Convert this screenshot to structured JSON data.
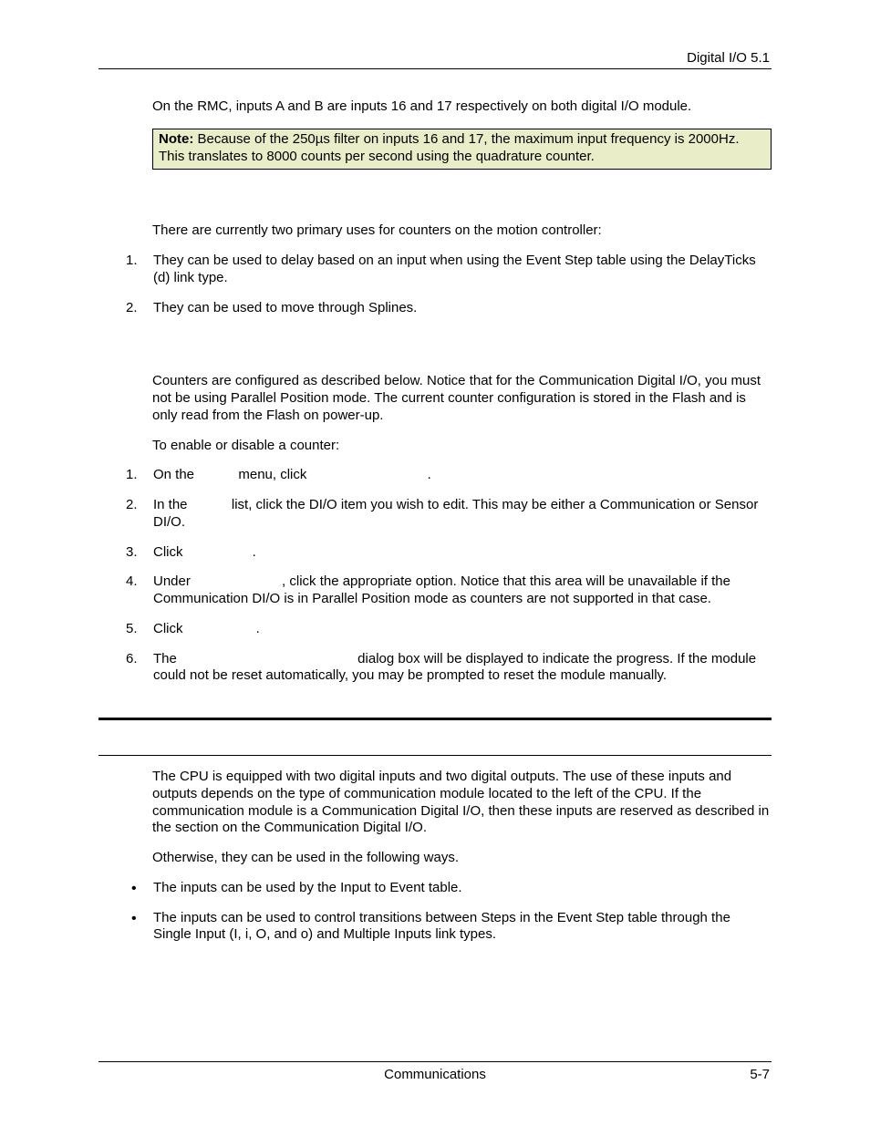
{
  "header": {
    "right": "Digital I/O  5.1"
  },
  "body": {
    "p1": "On the RMC, inputs A and B are inputs 16 and 17 respectively on both digital I/O module.",
    "note_label": "Note:",
    "note_text": " Because of the 250µs filter on inputs 16 and 17, the maximum input frequency is 2000Hz. This translates to 8000 counts per second using the quadrature counter.",
    "p2": "There are currently two primary uses for counters on the motion controller:",
    "list1": {
      "i1": "They can be used to delay based on an input when using the Event Step table using the DelayTicks (d) link type.",
      "i2": "They can be used to move through Splines."
    },
    "p3": "Counters are configured as described below. Notice that for the Communication Digital I/O, you must not be using Parallel Position mode. The current counter configuration is stored in the Flash and is only read from the Flash on power-up.",
    "p4": "To enable or disable a counter:",
    "list2": {
      "i1a": "On the ",
      "i1b": " menu, click ",
      "i1c": ".",
      "i2a": "In the ",
      "i2b": " list, click the DI/O item you wish to edit. This may be either a Communication or Sensor DI/O.",
      "i3a": "Click ",
      "i3b": ".",
      "i4a": "Under ",
      "i4b": ", click the appropriate option. Notice that this area will be unavailable if the Communication DI/O is in Parallel Position mode as counters are not supported in that case.",
      "i5a": "Click ",
      "i5b": ".",
      "i6a": "The ",
      "i6b": " dialog box will be displayed to indicate the progress. If the module could not be reset automatically, you may be prompted to reset the module manually."
    },
    "p5": "The CPU is equipped with two digital inputs and two digital outputs. The use of these inputs and outputs depends on the type of communication module located to the left of the CPU. If the communication module is a Communication Digital I/O, then these inputs are reserved as described in the section on the Communication Digital I/O.",
    "p6": "Otherwise, they can be used in the following ways.",
    "bullets": {
      "b1": "The inputs can be used by the Input to Event table.",
      "b2": "The inputs can be used to control transitions between Steps in the Event Step table through the Single Input (I, i, O, and o) and Multiple Inputs link types."
    }
  },
  "footer": {
    "center": "Communications",
    "right": "5-7"
  }
}
